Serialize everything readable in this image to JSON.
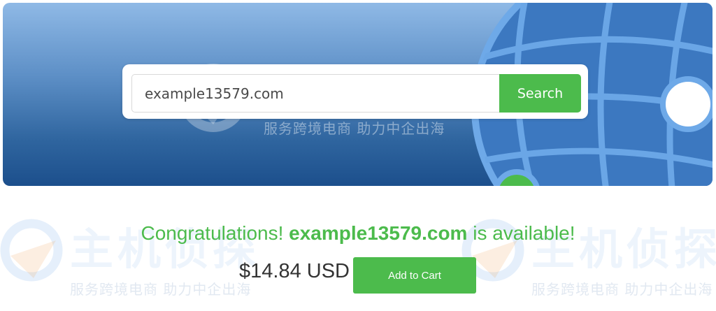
{
  "search": {
    "value": "example13579.com",
    "button_label": "Search"
  },
  "result": {
    "prefix": "Congratulations! ",
    "domain": "example13579.com",
    "suffix": " is available!",
    "price": "$14.84 USD",
    "add_to_cart_label": "Add to Cart"
  },
  "watermark": {
    "title": "主机侦探",
    "subtitle": "服务跨境电商 助力中企出海"
  },
  "colors": {
    "accent_green": "#4cbb4c",
    "banner_blue": "#2f659f",
    "globe_blue": "#4a8fd6"
  }
}
